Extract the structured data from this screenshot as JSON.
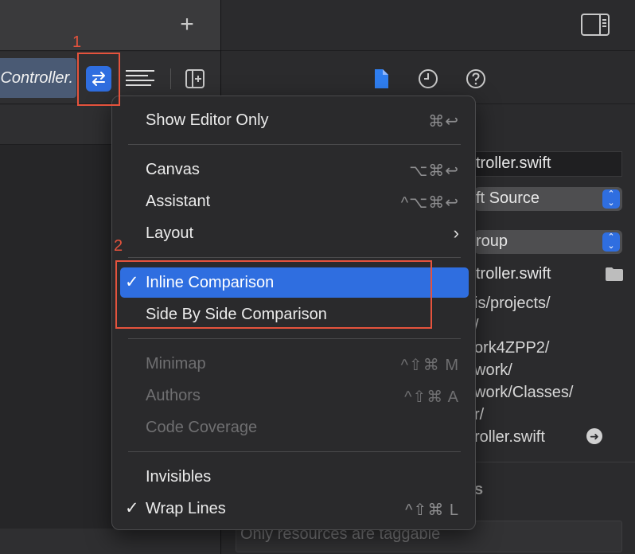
{
  "editor": {
    "file_tab_label": "Controller."
  },
  "inspector": {
    "filename": "troller.swift",
    "type_popup": "ft Source",
    "location_popup": "roup",
    "full_path_name": "troller.swift",
    "path_lines": [
      "is/projects/",
      "/",
      "ork4ZPP2/",
      "work/",
      "work/Classes/",
      "r/",
      "roller.swift"
    ],
    "tags_title": "s",
    "tags_placeholder": "Only resources are taggable"
  },
  "menu": {
    "show_editor_only": {
      "label": "Show Editor Only",
      "shortcut": "⌘↩"
    },
    "canvas": {
      "label": "Canvas",
      "shortcut": "⌥⌘↩"
    },
    "assistant": {
      "label": "Assistant",
      "shortcut": "^⌥⌘↩"
    },
    "layout": {
      "label": "Layout"
    },
    "inline_comparison": {
      "label": "Inline Comparison",
      "checked": true
    },
    "side_by_side": {
      "label": "Side By Side Comparison"
    },
    "minimap": {
      "label": "Minimap",
      "shortcut": "^⇧⌘ M"
    },
    "authors": {
      "label": "Authors",
      "shortcut": "^⇧⌘ A"
    },
    "code_coverage": {
      "label": "Code Coverage"
    },
    "invisibles": {
      "label": "Invisibles"
    },
    "wrap_lines": {
      "label": "Wrap Lines",
      "shortcut": "^⇧⌘ L",
      "checked": true
    }
  },
  "annotations": {
    "step1": "1",
    "step2": "2"
  },
  "colors": {
    "accent": "#2f6ee0",
    "annotation": "#e5533d"
  }
}
